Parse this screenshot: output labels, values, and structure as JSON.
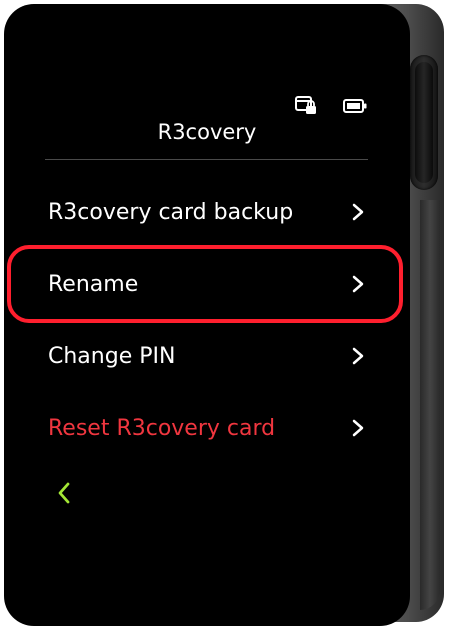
{
  "header": {
    "title": "R3covery",
    "icons": [
      "card-lock-icon",
      "battery-icon"
    ]
  },
  "menu": {
    "items": [
      {
        "label": "R3covery card backup",
        "icon": "chevron-right-icon",
        "color": "#ffffff"
      },
      {
        "label": "Rename",
        "icon": "chevron-right-icon",
        "color": "#ffffff",
        "highlighted": true
      },
      {
        "label": "Change PIN",
        "icon": "chevron-right-icon",
        "color": "#ffffff"
      },
      {
        "label": "Reset R3covery card",
        "icon": "chevron-right-icon",
        "color": "#f0363f"
      }
    ]
  },
  "footer": {
    "back_icon": "chevron-left-icon",
    "back_color": "#a3e635"
  },
  "colors": {
    "screen_bg": "#000000",
    "highlight": "#ff1f2e",
    "danger": "#f0363f",
    "accent": "#a3e635"
  }
}
